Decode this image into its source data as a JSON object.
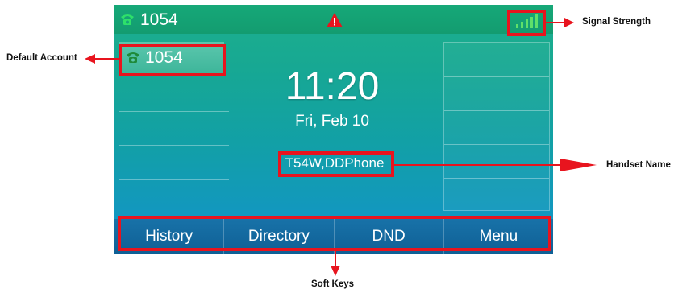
{
  "topbar": {
    "account": "1054",
    "phone_icon": "phone-icon",
    "alert_icon": "warning-icon",
    "signal_icon": "signal-strength-icon"
  },
  "account_panel": {
    "label": "1054"
  },
  "clock": {
    "time": "11:20",
    "date": "Fri, Feb 10"
  },
  "handset_name": "T54W,DDPhone",
  "softkeys": [
    "History",
    "Directory",
    "DND",
    "Menu"
  ],
  "annotations": {
    "signal_strength": "Signal Strength",
    "default_account": "Default Account",
    "handset_name": "Handset Name",
    "soft_keys": "Soft Keys"
  },
  "colors": {
    "highlight": "#e8141e",
    "topbar": "#16a878",
    "softkey_bar": "#1872a8",
    "phone_icon": "#2ee06a",
    "alert": "#e8141e"
  }
}
